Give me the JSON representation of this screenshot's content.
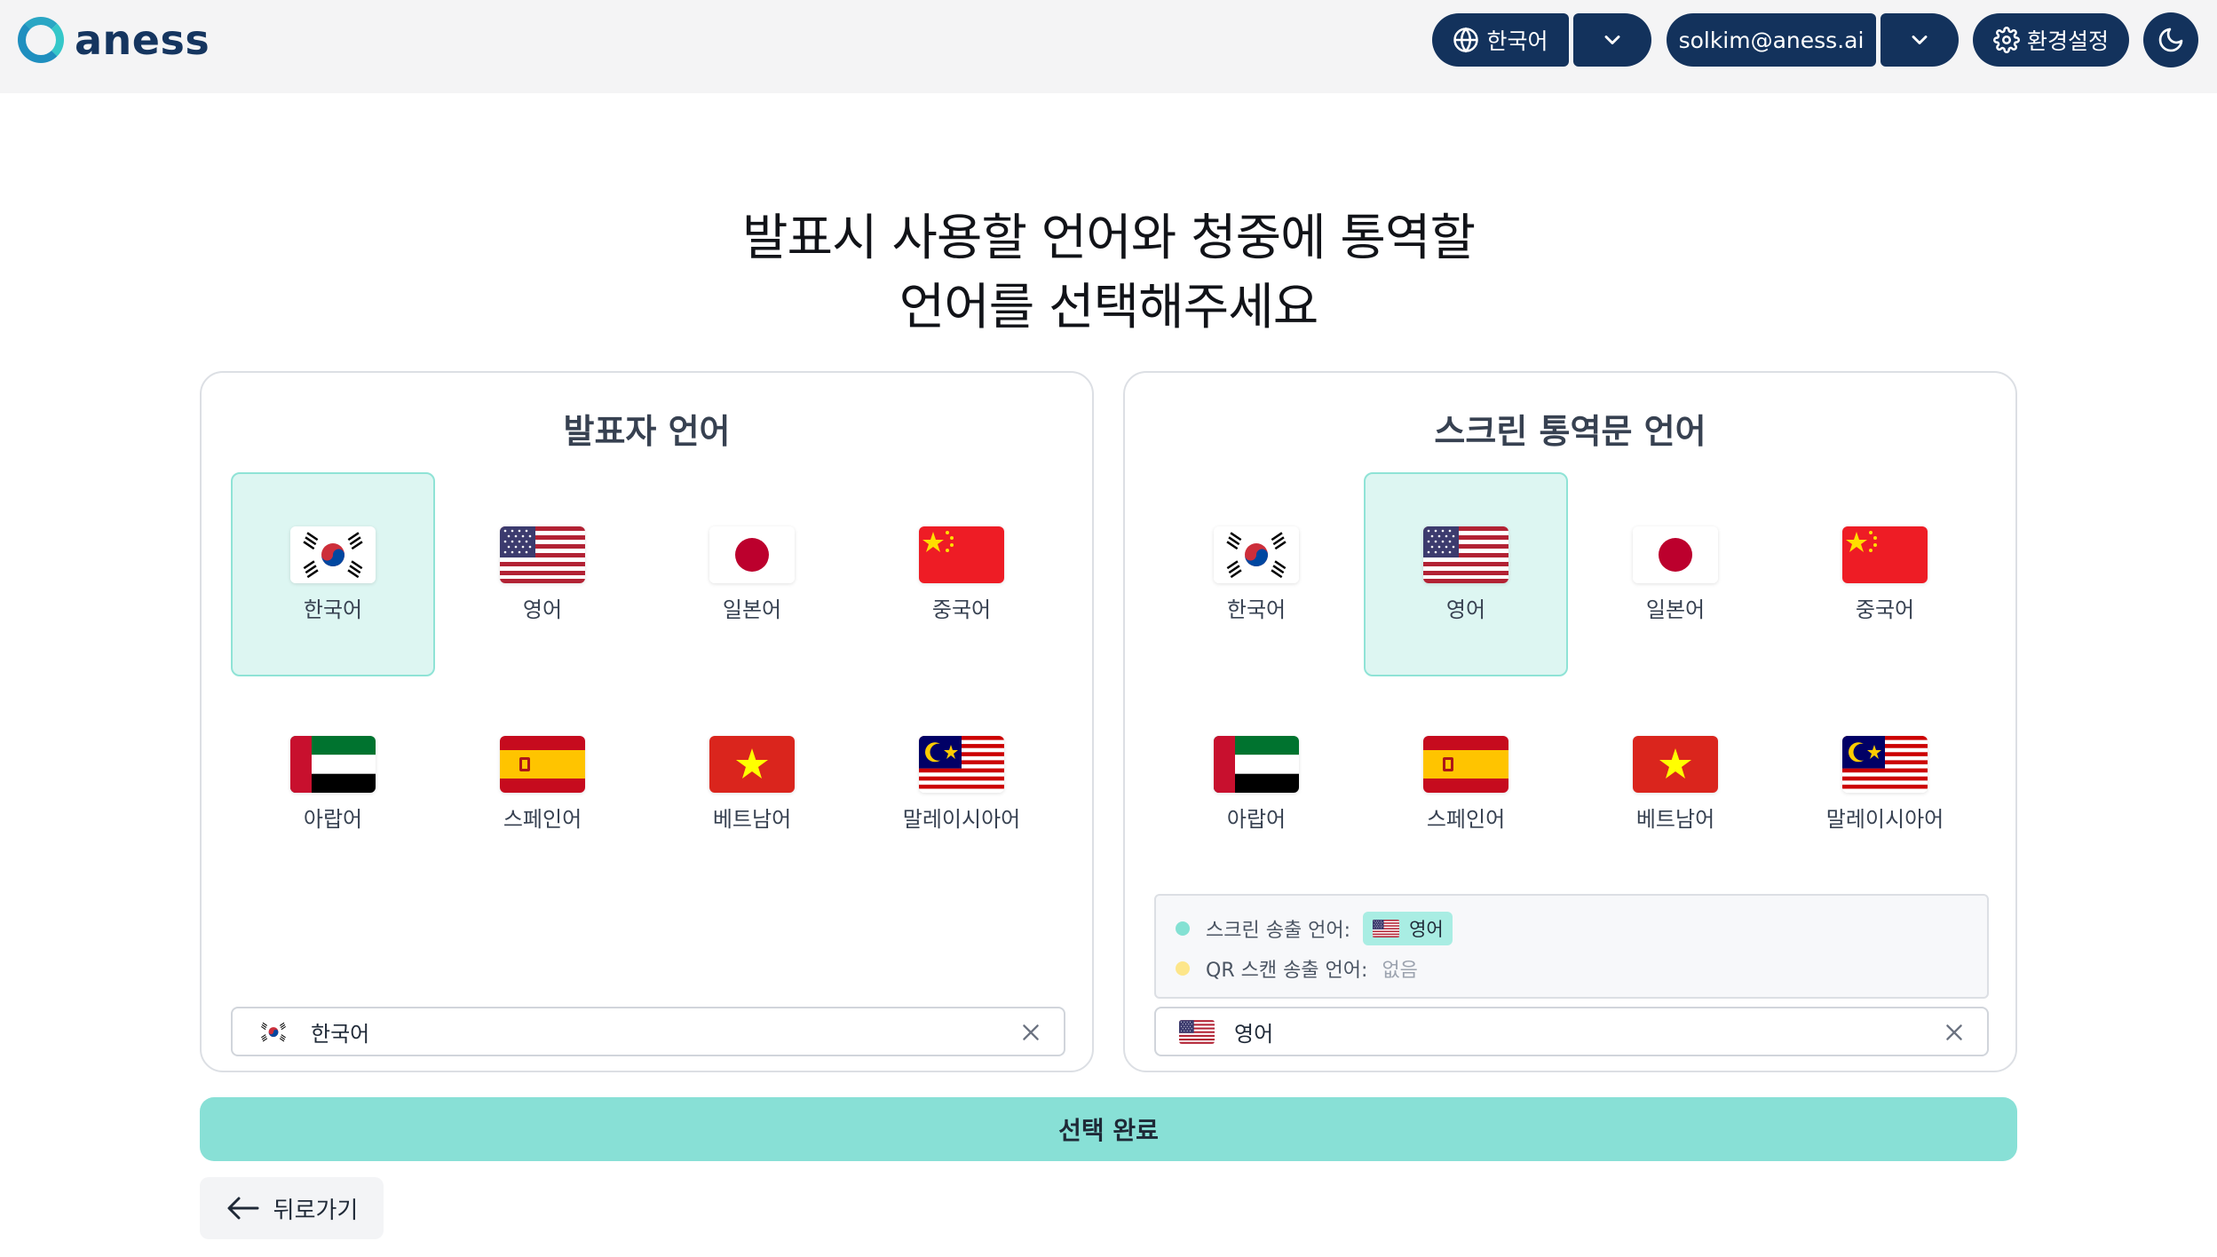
{
  "app": {
    "logo_text": "aness"
  },
  "header": {
    "language_label": "한국어",
    "user_email": "solkim@aness.ai",
    "settings_label": "환경설정"
  },
  "headline": {
    "line1": "발표시 사용할 언어와 청중에 통역할",
    "line2": "언어를 선택해주세요"
  },
  "speaker_panel": {
    "title": "발표자 언어",
    "languages": [
      {
        "label": "한국어",
        "flag": "kr-flag",
        "selected": true
      },
      {
        "label": "영어",
        "flag": "us-flag",
        "selected": false
      },
      {
        "label": "일본어",
        "flag": "jp-flag",
        "selected": false
      },
      {
        "label": "중국어",
        "flag": "cn-flag",
        "selected": false
      },
      {
        "label": "아랍어",
        "flag": "ae-flag",
        "selected": false
      },
      {
        "label": "스페인어",
        "flag": "es-flag",
        "selected": false
      },
      {
        "label": "베트남어",
        "flag": "vn-flag",
        "selected": false
      },
      {
        "label": "말레이시아어",
        "flag": "my-flag",
        "selected": false
      }
    ],
    "selected_value": "한국어"
  },
  "screen_panel": {
    "title": "스크린 통역문 언어",
    "languages": [
      {
        "label": "한국어",
        "flag": "kr-flag",
        "selected": false
      },
      {
        "label": "영어",
        "flag": "us-flag",
        "selected": true
      },
      {
        "label": "일본어",
        "flag": "jp-flag",
        "selected": false
      },
      {
        "label": "중국어",
        "flag": "cn-flag",
        "selected": false
      },
      {
        "label": "아랍어",
        "flag": "ae-flag",
        "selected": false
      },
      {
        "label": "스페인어",
        "flag": "es-flag",
        "selected": false
      },
      {
        "label": "베트남어",
        "flag": "vn-flag",
        "selected": false
      },
      {
        "label": "말레이시아어",
        "flag": "my-flag",
        "selected": false
      }
    ],
    "status": {
      "screen_output_label": "스크린 송출 언어:",
      "screen_output_value": "영어",
      "qr_output_label": "QR 스캔 송출 언어:",
      "qr_output_value": "없음"
    },
    "selected_value": "영어"
  },
  "actions": {
    "submit_label": "선택 완료",
    "back_label": "뒤로가기"
  },
  "colors": {
    "navy": "#13325c",
    "accent_teal": "#88e0d6",
    "selected_bg": "#ddf6f2"
  }
}
